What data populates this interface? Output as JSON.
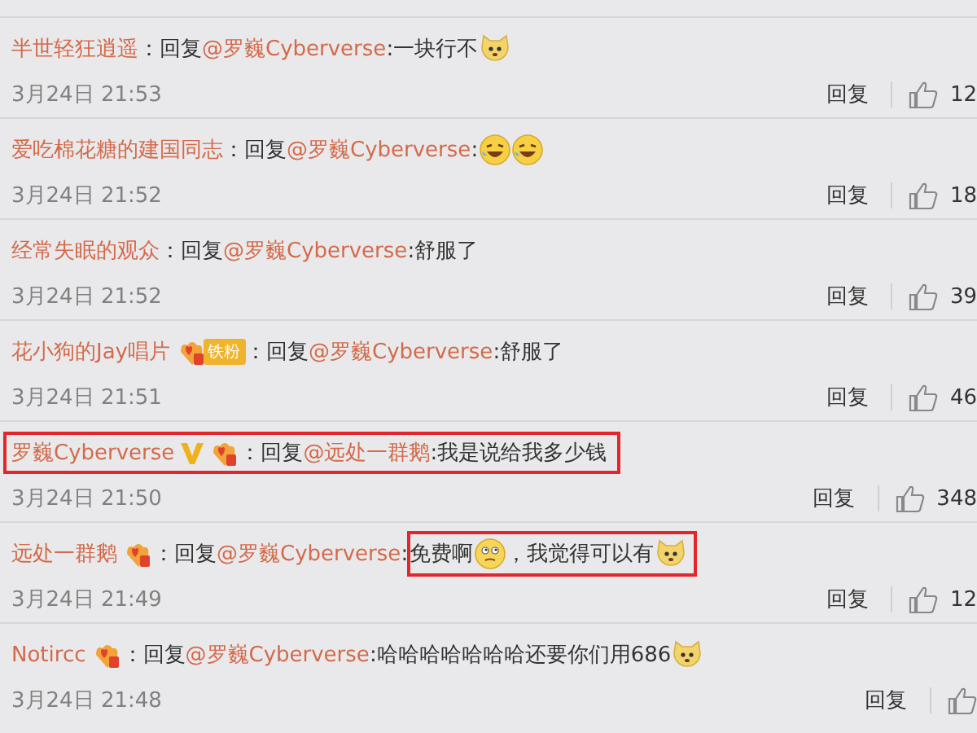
{
  "comments": [
    {
      "user": "半世轻狂逍遥",
      "highlighted": false,
      "content": [
        {
          "kind": "text",
          "text": "：回复"
        },
        {
          "kind": "mention",
          "text": "@罗巍Cyberverse"
        },
        {
          "kind": "text",
          "text": ":一块行不"
        },
        {
          "kind": "dog-emoji"
        }
      ],
      "time": "3月24日 21:53",
      "reply": "回复",
      "likes": "12"
    },
    {
      "user": "爱吃棉花糖的建国同志",
      "highlighted": false,
      "content": [
        {
          "kind": "text",
          "text": "：回复"
        },
        {
          "kind": "mention",
          "text": "@罗巍Cyberverse"
        },
        {
          "kind": "text",
          "text": ":"
        },
        {
          "kind": "laugh-emoji"
        },
        {
          "kind": "laugh-emoji"
        }
      ],
      "time": "3月24日 21:52",
      "reply": "回复",
      "likes": "18"
    },
    {
      "user": "经常失眠的观众",
      "highlighted": false,
      "content": [
        {
          "kind": "text",
          "text": "：回复 "
        },
        {
          "kind": "mention",
          "text": "@罗巍Cyberverse"
        },
        {
          "kind": "text",
          "text": ":舒服了"
        }
      ],
      "time": "3月24日 21:52",
      "reply": "回复",
      "likes": "39"
    },
    {
      "user": "花小狗的Jay唱片",
      "badges": [
        {
          "kind": "fan",
          "label": "铁粉"
        }
      ],
      "highlighted": false,
      "content": [
        {
          "kind": "text",
          "text": "：回复 "
        },
        {
          "kind": "mention",
          "text": "@罗巍Cyberverse"
        },
        {
          "kind": "text",
          "text": ":舒服了"
        }
      ],
      "time": "3月24日 21:51",
      "reply": "回复",
      "likes": "46"
    },
    {
      "user": "罗巍Cyberverse",
      "badges": [
        {
          "kind": "verified"
        },
        {
          "kind": "fan"
        }
      ],
      "highlighted": true,
      "content": [
        {
          "kind": "text",
          "text": "：回复"
        },
        {
          "kind": "mention",
          "text": "@远处一群鹅"
        },
        {
          "kind": "text",
          "text": ":我是说给我多少钱"
        }
      ],
      "time": "3月24日 21:50",
      "reply": "回复",
      "likes": "348"
    },
    {
      "user": "远处一群鹅",
      "badges": [
        {
          "kind": "fan"
        }
      ],
      "highlighted": false,
      "content": [
        {
          "kind": "text",
          "text": "：回复"
        },
        {
          "kind": "mention",
          "text": "@罗巍Cyberverse"
        },
        {
          "kind": "text",
          "text": ":"
        },
        {
          "kind": "highlight",
          "segments": [
            {
              "kind": "text",
              "text": "免费啊"
            },
            {
              "kind": "thinking-emoji"
            },
            {
              "kind": "text",
              "text": "，我觉得可以有"
            },
            {
              "kind": "dog-emoji"
            }
          ]
        }
      ],
      "time": "3月24日 21:49",
      "reply": "回复",
      "likes": "12"
    },
    {
      "user": "Notircc",
      "badges": [
        {
          "kind": "fan"
        }
      ],
      "highlighted": false,
      "content": [
        {
          "kind": "text",
          "text": "：回复"
        },
        {
          "kind": "mention",
          "text": "@罗巍Cyberverse"
        },
        {
          "kind": "text",
          "text": ":哈哈哈哈哈哈哈还要你们用686"
        },
        {
          "kind": "dog-emoji"
        }
      ],
      "time": "3月24日 21:48",
      "reply": "回复"
    }
  ]
}
